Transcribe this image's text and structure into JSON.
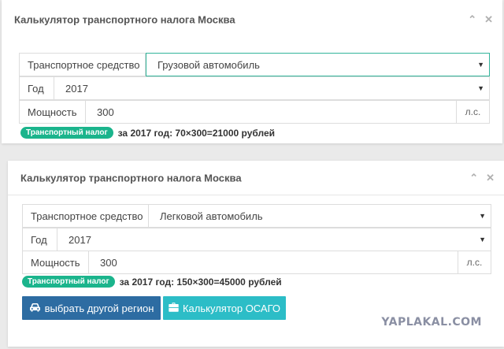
{
  "panel1": {
    "title": "Калькулятор транспортного налога Москва",
    "tool_collapse": "⌃",
    "tool_close": "✕",
    "vehicle_label": "Транспортное средство",
    "vehicle_value": "Грузовой автомобиль",
    "year_label": "Год",
    "year_value": "2017",
    "power_label": "Мощность",
    "power_value": "300",
    "power_unit": "л.с.",
    "badge": "Транспортный налог",
    "result_text": "за 2017 год: 70×300=21000 рублей"
  },
  "panel2": {
    "title": "Калькулятор транспортного налога Москва",
    "tool_collapse": "⌃",
    "tool_close": "✕",
    "vehicle_label": "Транспортное средство",
    "vehicle_value": "Легковой автомобиль",
    "year_label": "Год",
    "year_value": "2017",
    "power_label": "Мощность",
    "power_value": "300",
    "power_unit": "л.с.",
    "badge": "Транспортный налог",
    "result_text": "за 2017 год: 150×300=45000 рублей",
    "btn_region": "выбрать другой регион",
    "btn_osago": "Калькулятор ОСАГО"
  },
  "icons": {
    "caret": "▼",
    "car": "car-icon",
    "briefcase": "briefcase-icon"
  },
  "colors": {
    "badge": "#1bb48c",
    "focus_border": "#33b49b",
    "btn_region": "#2d6ca2",
    "btn_osago": "#2cbdc7"
  },
  "watermark": "YAPLAKAL.COM"
}
